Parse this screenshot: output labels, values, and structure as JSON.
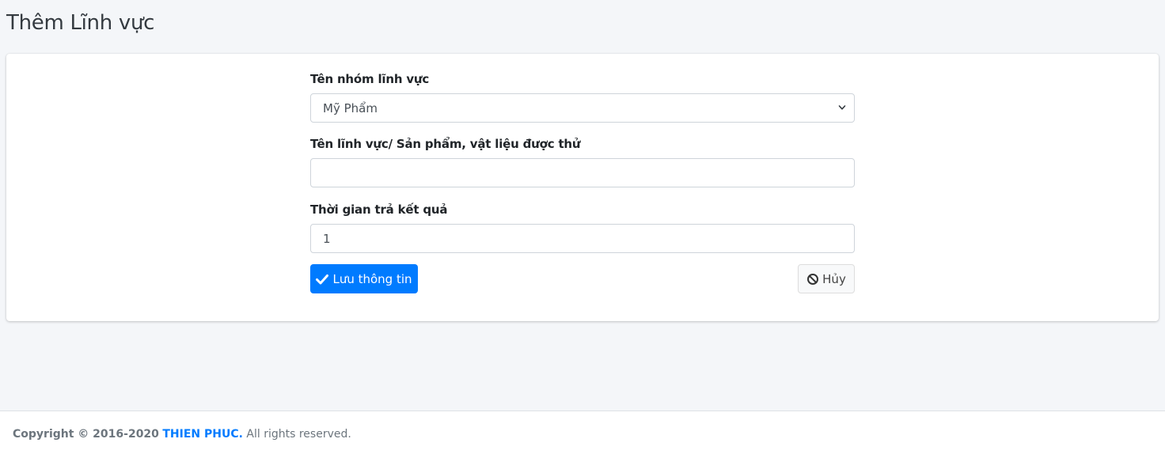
{
  "page": {
    "title": "Thêm Lĩnh vực"
  },
  "form": {
    "group_label": "Tên nhóm lĩnh vực",
    "group_selected": "Mỹ Phẩm",
    "field_label": "Tên lĩnh vực/ Sản phẩm, vật liệu được thử",
    "field_value": "",
    "time_label": "Thời gian trả kết quả",
    "time_value": "1"
  },
  "actions": {
    "save_label": "Lưu thông tin",
    "cancel_label": "Hủy"
  },
  "footer": {
    "copyright": "Copyright © 2016-2020",
    "brand": "THIEN PHUC.",
    "rights": "All rights reserved."
  },
  "colors": {
    "primary": "#007bff",
    "background": "#f4f6f9"
  },
  "icons": {
    "save": "check-icon",
    "cancel": "ban-icon",
    "select": "chevron-down-icon"
  }
}
